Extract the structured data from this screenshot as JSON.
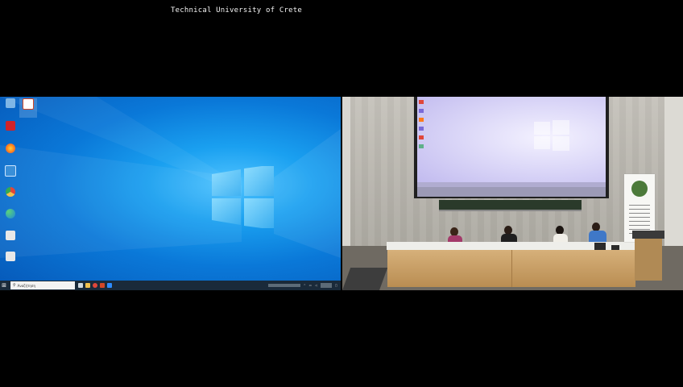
{
  "caption": "Technical University of Crete",
  "desktop": {
    "icons": [
      {
        "name": "recycle-bin-icon",
        "color": "#7fb6e6"
      },
      {
        "name": "powerpoint-file-icon",
        "color": "#d24726"
      },
      {
        "name": "acrobat-reader-icon",
        "color": "#d0232a"
      },
      {
        "name": "firefox-icon",
        "color": "#ff7a1a"
      },
      {
        "name": "webcam-app-icon",
        "color": "#3a8fd8"
      },
      {
        "name": "chrome-icon",
        "color": "#e0463a"
      },
      {
        "name": "edge-icon",
        "color": "#2fb0a8"
      },
      {
        "name": "quiz-app-icon",
        "color": "#e8e8e8"
      },
      {
        "name": "quiz-app-2-icon",
        "color": "#e8e8e8"
      }
    ],
    "taskbar": {
      "search_placeholder": "Αναζήτηση",
      "apps": [
        {
          "name": "task-view-icon",
          "color": "#cfd8e0"
        },
        {
          "name": "file-explorer-icon",
          "color": "#f2c14e"
        },
        {
          "name": "chrome-taskbar-icon",
          "color": "#e0463a"
        },
        {
          "name": "powerpoint-taskbar-icon",
          "color": "#d24726"
        },
        {
          "name": "zoom-taskbar-icon",
          "color": "#2d8cff"
        }
      ]
    }
  },
  "colors": {
    "desktop_blue": "#0a78d8",
    "taskbar_bg": "#1a2a3a",
    "logo_glow": "#7fd6ff",
    "table_wood": "#c9a06a"
  }
}
